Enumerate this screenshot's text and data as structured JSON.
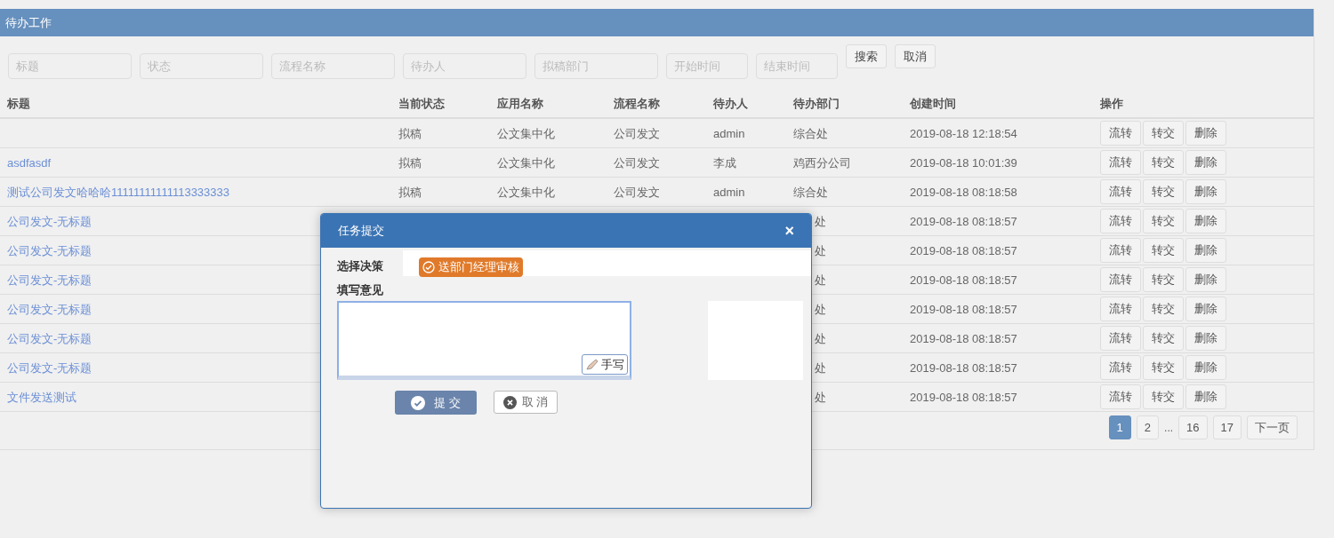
{
  "panel": {
    "title": "待办工作"
  },
  "filters": [
    {
      "placeholder": "标题"
    },
    {
      "placeholder": "状态"
    },
    {
      "placeholder": "流程名称"
    },
    {
      "placeholder": "待办人"
    },
    {
      "placeholder": "拟稿部门"
    },
    {
      "placeholder": "开始时间",
      "kind": "short"
    },
    {
      "placeholder": "结束时间",
      "kind": "short"
    }
  ],
  "filter_buttons": [
    "搜索",
    "取消"
  ],
  "table": {
    "columns": [
      "标题",
      "当前状态",
      "应用名称",
      "流程名称",
      "待办人",
      "待办部门",
      "创建时间",
      "操作"
    ],
    "rows": [
      {
        "status": "拟稿",
        "app": "公文集中化",
        "flow": "公司发文",
        "person": "admin",
        "dept": "综合处",
        "created": "2019-08-18 12:18:54"
      },
      {
        "title": "asdfasdf",
        "status": "拟稿",
        "app": "公文集中化",
        "flow": "公司发文",
        "person": "李成",
        "dept": "鸡西分公司",
        "created": "2019-08-18 10:01:39"
      },
      {
        "title": "测试公司发文哈哈哈11111111111113333333",
        "status": "拟稿",
        "app": "公文集中化",
        "flow": "公司发文",
        "person": "admin",
        "dept": "综合处",
        "created": "2019-08-18 08:18:58"
      },
      {
        "title": "公司发文-无标题",
        "dept": "处",
        "created": "2019-08-18 08:18:57"
      },
      {
        "title": "公司发文-无标题",
        "dept": "处",
        "created": "2019-08-18 08:18:57"
      },
      {
        "title": "公司发文-无标题",
        "dept": "处",
        "created": "2019-08-18 08:18:57"
      },
      {
        "title": "公司发文-无标题",
        "dept": "处",
        "created": "2019-08-18 08:18:57"
      },
      {
        "title": "公司发文-无标题",
        "dept": "处",
        "created": "2019-08-18 08:18:57"
      },
      {
        "title": "公司发文-无标题",
        "dept": "处",
        "created": "2019-08-18 08:18:57"
      },
      {
        "title": "文件发送测试",
        "dept": "处",
        "created": "2019-08-18 08:18:57"
      }
    ],
    "row_actions": [
      [
        "流转",
        "转交",
        "删除"
      ],
      [
        "流转",
        "转交",
        "删除"
      ],
      [
        "流转",
        "转交",
        "删除"
      ],
      [
        "流转",
        "转交",
        "删除"
      ],
      [
        "流转",
        "转交",
        "删除"
      ],
      [
        "流转",
        "转交",
        "删除"
      ],
      [
        "流转",
        "转交",
        "删除"
      ],
      [
        "流转",
        "转交",
        "删除"
      ],
      [
        "流转",
        "转交",
        "删除"
      ],
      [
        "流转",
        "转交",
        "删除"
      ]
    ]
  },
  "pagination": [
    {
      "label": "1",
      "selected": true
    },
    {
      "label": "2",
      "selected": false
    },
    {
      "label": "...",
      "kind": "gap"
    },
    {
      "label": "16",
      "selected": false
    },
    {
      "label": "17",
      "selected": false
    },
    {
      "label": "下一页",
      "selected": false
    }
  ],
  "dialog": {
    "title": "任务提交",
    "close": "×",
    "decision_label": "选择决策",
    "decision": "送部门经理审核",
    "opinion_label": "填写意见",
    "handwrite": "手写",
    "submit": "提 交",
    "cancel": "取 消"
  }
}
